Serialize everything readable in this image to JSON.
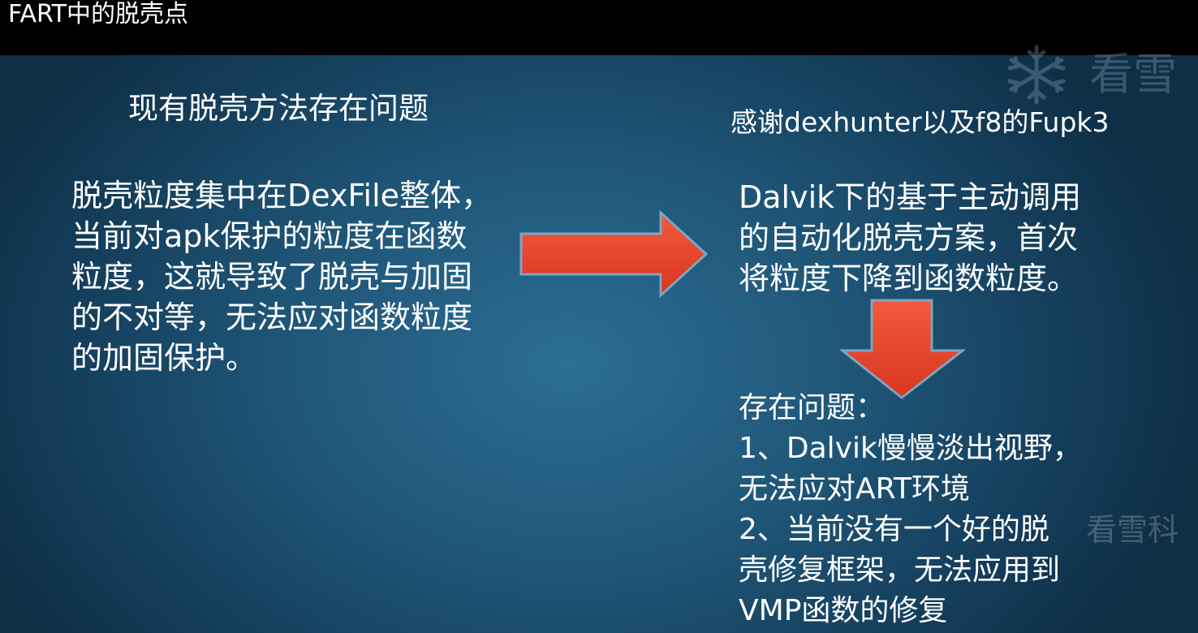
{
  "title": "FART中的脱壳点",
  "watermark": {
    "top_text": "看雪",
    "bottom_text": "看雪科"
  },
  "left": {
    "heading": "现有脱壳方法存在问题",
    "body_lines": [
      "脱壳粒度集中在DexFile整体，",
      "当前对apk保护的粒度在函数",
      "粒度，这就导致了脱壳与加固",
      "的不对等，无法应对函数粒度",
      "的加固保护。"
    ]
  },
  "right": {
    "heading": "感谢dexhunter以及f8的Fupk3",
    "body_lines": [
      "Dalvik下的基于主动调用",
      "的自动化脱壳方案，首次",
      "将粒度下降到函数粒度。"
    ]
  },
  "issues": {
    "lines": [
      "存在问题：",
      "1、Dalvik慢慢淡出视野，",
      "无法应对ART环境",
      "2、当前没有一个好的脱",
      "壳修复框架，无法应用到",
      "VMP函数的修复"
    ]
  },
  "colors": {
    "title_bar": "#000000",
    "background": "#1f5678",
    "arrow_fill": "#e8402a",
    "arrow_edge": "#8fb1c9",
    "text": "#ffffff"
  },
  "icons": {
    "arrow_right": "right-arrow-icon",
    "arrow_down": "down-arrow-icon",
    "watermark_logo": "snowflake-icon"
  }
}
